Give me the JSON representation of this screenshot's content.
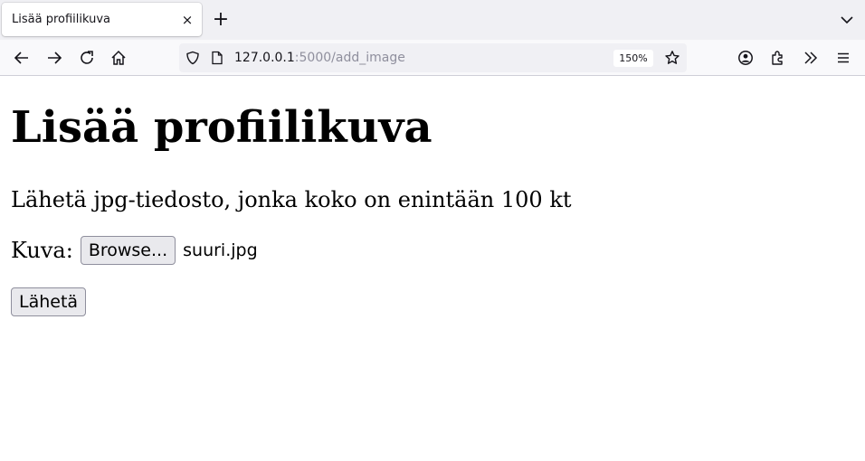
{
  "browser": {
    "tab": {
      "title": "Lisää profiilikuva",
      "close_glyph": "×"
    },
    "new_tab_glyph": "+",
    "url": {
      "host": "127.0.0.1",
      "path": ":5000/add_image"
    },
    "zoom": "150%",
    "icons": [
      "back-icon",
      "forward-icon",
      "reload-icon",
      "home-icon",
      "shield-icon",
      "page-icon",
      "star-icon",
      "account-icon",
      "extensions-icon",
      "overflow-icon",
      "menu-icon",
      "tab-list-icon"
    ]
  },
  "page": {
    "heading": "Lisää profiilikuva",
    "instruction": "Lähetä jpg-tiedosto, jonka koko on enintään 100 kt",
    "image_label": "Kuva:",
    "browse_label": "Browse...",
    "selected_file": "suuri.jpg",
    "submit_label": "Lähetä"
  }
}
